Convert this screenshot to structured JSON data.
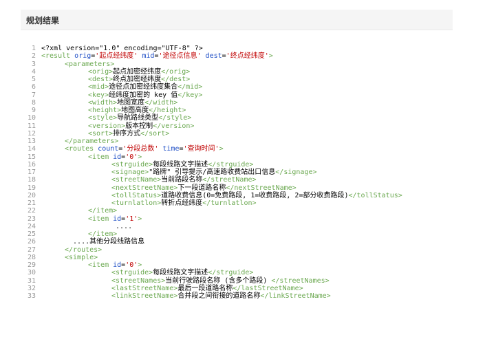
{
  "header": {
    "title": "规划结果"
  },
  "code": {
    "lines": [
      {
        "n": "1",
        "indent": 0,
        "parts": [
          {
            "t": "<?xml version=\"1.0\" encoding=\"UTF-8\" ?>",
            "c": "plain"
          }
        ]
      },
      {
        "n": "2",
        "indent": 0,
        "parts": [
          {
            "t": "<result ",
            "c": "tag"
          },
          {
            "t": "orig",
            "c": "attr"
          },
          {
            "t": "=",
            "c": "plain"
          },
          {
            "t": "'起点经纬度'",
            "c": "val"
          },
          {
            "t": " ",
            "c": "plain"
          },
          {
            "t": "mid",
            "c": "attr"
          },
          {
            "t": "=",
            "c": "plain"
          },
          {
            "t": "'途径点信息'",
            "c": "val"
          },
          {
            "t": " ",
            "c": "plain"
          },
          {
            "t": "dest",
            "c": "attr"
          },
          {
            "t": "=",
            "c": "plain"
          },
          {
            "t": "'终点经纬度'",
            "c": "val"
          },
          {
            "t": ">",
            "c": "tag"
          }
        ]
      },
      {
        "n": "3",
        "indent": 1,
        "parts": [
          {
            "t": "<parameters>",
            "c": "tag"
          }
        ]
      },
      {
        "n": "4",
        "indent": 2,
        "parts": [
          {
            "t": "<orig>",
            "c": "tag"
          },
          {
            "t": "起点加密经纬度",
            "c": "plain"
          },
          {
            "t": "</orig>",
            "c": "tag"
          }
        ]
      },
      {
        "n": "5",
        "indent": 2,
        "parts": [
          {
            "t": "<dest>",
            "c": "tag"
          },
          {
            "t": "终点加密经纬度",
            "c": "plain"
          },
          {
            "t": "</dest>",
            "c": "tag"
          }
        ]
      },
      {
        "n": "6",
        "indent": 2,
        "parts": [
          {
            "t": "<mid>",
            "c": "tag"
          },
          {
            "t": "途径点加密经纬度集合",
            "c": "plain"
          },
          {
            "t": "</mid>",
            "c": "tag"
          }
        ]
      },
      {
        "n": "7",
        "indent": 2,
        "parts": [
          {
            "t": "<key>",
            "c": "tag"
          },
          {
            "t": "经纬度加密的 key 值",
            "c": "plain"
          },
          {
            "t": "</key>",
            "c": "tag"
          }
        ]
      },
      {
        "n": "8",
        "indent": 2,
        "parts": [
          {
            "t": "<width>",
            "c": "tag"
          },
          {
            "t": "地图宽度",
            "c": "plain"
          },
          {
            "t": "</width>",
            "c": "tag"
          }
        ]
      },
      {
        "n": "9",
        "indent": 2,
        "parts": [
          {
            "t": "<height>",
            "c": "tag"
          },
          {
            "t": "地图高度",
            "c": "plain"
          },
          {
            "t": "</height>",
            "c": "tag"
          }
        ]
      },
      {
        "n": "10",
        "indent": 2,
        "parts": [
          {
            "t": "<style>",
            "c": "tag"
          },
          {
            "t": "导航路线类型",
            "c": "plain"
          },
          {
            "t": "</style>",
            "c": "tag"
          }
        ]
      },
      {
        "n": "11",
        "indent": 2,
        "parts": [
          {
            "t": "<version>",
            "c": "tag"
          },
          {
            "t": "版本控制",
            "c": "plain"
          },
          {
            "t": "</version>",
            "c": "tag"
          }
        ]
      },
      {
        "n": "12",
        "indent": 2,
        "parts": [
          {
            "t": "<sort>",
            "c": "tag"
          },
          {
            "t": "排序方式",
            "c": "plain"
          },
          {
            "t": "</sort>",
            "c": "tag"
          }
        ]
      },
      {
        "n": "13",
        "indent": 1,
        "parts": [
          {
            "t": "</parameters>",
            "c": "tag"
          }
        ]
      },
      {
        "n": "14",
        "indent": 1,
        "parts": [
          {
            "t": "<routes ",
            "c": "tag"
          },
          {
            "t": "count",
            "c": "attr"
          },
          {
            "t": "=",
            "c": "plain"
          },
          {
            "t": "'分段总数'",
            "c": "val"
          },
          {
            "t": " ",
            "c": "plain"
          },
          {
            "t": "time",
            "c": "attr"
          },
          {
            "t": "=",
            "c": "plain"
          },
          {
            "t": "'查询时间'",
            "c": "val"
          },
          {
            "t": ">",
            "c": "tag"
          }
        ]
      },
      {
        "n": "15",
        "indent": 2,
        "parts": [
          {
            "t": "<item ",
            "c": "tag"
          },
          {
            "t": "id",
            "c": "attr"
          },
          {
            "t": "=",
            "c": "plain"
          },
          {
            "t": "'0'",
            "c": "val"
          },
          {
            "t": ">",
            "c": "tag"
          }
        ]
      },
      {
        "n": "16",
        "indent": 3,
        "parts": [
          {
            "t": "<strguide>",
            "c": "tag"
          },
          {
            "t": "每段线路文字描述",
            "c": "plain"
          },
          {
            "t": "</strguide>",
            "c": "tag"
          }
        ]
      },
      {
        "n": "17",
        "indent": 3,
        "parts": [
          {
            "t": "<signage>",
            "c": "tag"
          },
          {
            "t": "\"路牌\" 引导提示/高速路收费站出口信息",
            "c": "plain"
          },
          {
            "t": "</signage>",
            "c": "tag"
          }
        ]
      },
      {
        "n": "18",
        "indent": 3,
        "parts": [
          {
            "t": "<streetName>",
            "c": "tag"
          },
          {
            "t": "当前路段名称",
            "c": "plain"
          },
          {
            "t": "</streetName>",
            "c": "tag"
          }
        ]
      },
      {
        "n": "19",
        "indent": 3,
        "parts": [
          {
            "t": "<nextStreetName>",
            "c": "tag"
          },
          {
            "t": "下一段道路名称",
            "c": "plain"
          },
          {
            "t": "</nextStreetName>",
            "c": "tag"
          }
        ]
      },
      {
        "n": "20",
        "indent": 3,
        "parts": [
          {
            "t": "<tollStatus>",
            "c": "tag"
          },
          {
            "t": "道路收费信息(0=免费路段, 1=收费路段, 2=部分收费路段)",
            "c": "plain"
          },
          {
            "t": "</tollStatus>",
            "c": "tag"
          }
        ]
      },
      {
        "n": "21",
        "indent": 3,
        "parts": [
          {
            "t": "<turnlatlon>",
            "c": "tag"
          },
          {
            "t": "转折点经纬度",
            "c": "plain"
          },
          {
            "t": "</turnlatlon>",
            "c": "tag"
          }
        ]
      },
      {
        "n": "22",
        "indent": 2,
        "parts": [
          {
            "t": "</item>",
            "c": "tag"
          }
        ]
      },
      {
        "n": "23",
        "indent": 2,
        "parts": [
          {
            "t": "<item ",
            "c": "tag"
          },
          {
            "t": "id",
            "c": "attr"
          },
          {
            "t": "=",
            "c": "plain"
          },
          {
            "t": "'1'",
            "c": "val"
          },
          {
            "t": ">",
            "c": "tag"
          }
        ]
      },
      {
        "n": "24",
        "indent": 3,
        "parts": [
          {
            "t": " ....",
            "c": "plain"
          }
        ]
      },
      {
        "n": "25",
        "indent": 2,
        "parts": [
          {
            "t": "</item>",
            "c": "tag"
          }
        ]
      },
      {
        "n": "26",
        "indent": 1,
        "parts": [
          {
            "t": "  ....其他分段线路信息",
            "c": "plain"
          }
        ]
      },
      {
        "n": "27",
        "indent": 1,
        "parts": [
          {
            "t": "</routes>",
            "c": "tag"
          }
        ]
      },
      {
        "n": "28",
        "indent": 1,
        "parts": [
          {
            "t": "<simple>",
            "c": "tag"
          }
        ]
      },
      {
        "n": "29",
        "indent": 2,
        "parts": [
          {
            "t": "<item ",
            "c": "tag"
          },
          {
            "t": "id",
            "c": "attr"
          },
          {
            "t": "=",
            "c": "plain"
          },
          {
            "t": "'0'",
            "c": "val"
          },
          {
            "t": ">",
            "c": "tag"
          }
        ]
      },
      {
        "n": "30",
        "indent": 3,
        "parts": [
          {
            "t": "<strguide>",
            "c": "tag"
          },
          {
            "t": "每段线路文字描述",
            "c": "plain"
          },
          {
            "t": "</strguide>",
            "c": "tag"
          }
        ]
      },
      {
        "n": "31",
        "indent": 3,
        "parts": [
          {
            "t": "<streetNames>",
            "c": "tag"
          },
          {
            "t": "当前行驶路段名称 (含多个路段) ",
            "c": "plain"
          },
          {
            "t": "</streetNames>",
            "c": "tag"
          }
        ]
      },
      {
        "n": "32",
        "indent": 3,
        "parts": [
          {
            "t": "<lastStreetName>",
            "c": "tag"
          },
          {
            "t": "最后一段道路名称",
            "c": "plain"
          },
          {
            "t": "</lastStreetName>",
            "c": "tag"
          }
        ]
      },
      {
        "n": "33",
        "indent": 3,
        "parts": [
          {
            "t": "<linkStreetName>",
            "c": "tag"
          },
          {
            "t": "合并段之间衔接的道路名称",
            "c": "plain"
          },
          {
            "t": "</linkStreetName>",
            "c": "tag"
          }
        ]
      }
    ]
  }
}
